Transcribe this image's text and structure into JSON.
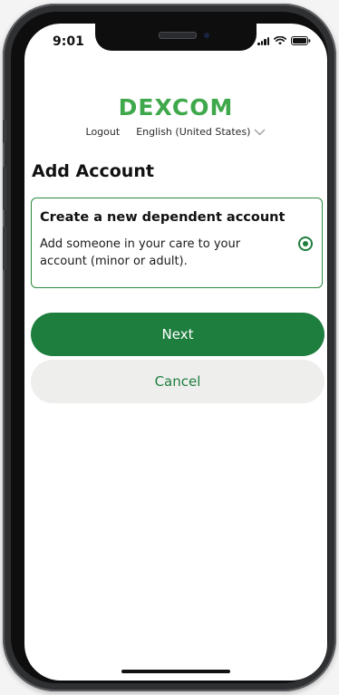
{
  "status_bar": {
    "time": "9:01",
    "icons": [
      "signal-icon",
      "wifi-icon",
      "battery-icon"
    ]
  },
  "brand": {
    "logo_text": "DEXCOM",
    "color": "#3fa84b"
  },
  "header": {
    "logout_label": "Logout",
    "language_label": "English (United States)",
    "language_icon": "chevron-down-icon"
  },
  "page": {
    "title": "Add Account"
  },
  "option": {
    "title": "Create a new dependent account",
    "description": "Add someone in your care to your account (minor or adult).",
    "selected": true
  },
  "actions": {
    "next_label": "Next",
    "cancel_label": "Cancel"
  },
  "colors": {
    "primary": "#1e7e3e",
    "secondary_bg": "#eeeeed"
  }
}
